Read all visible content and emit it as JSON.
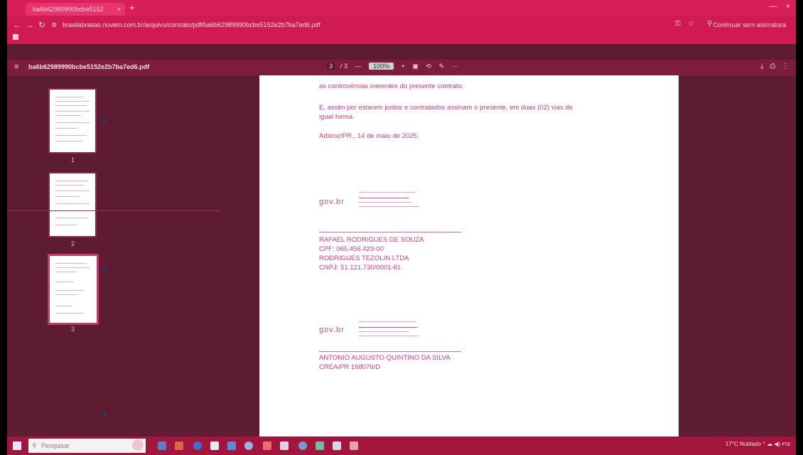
{
  "browser": {
    "tab_title": "ba6b62989990bcbe5152",
    "tab_close": "×",
    "new_tab": "+",
    "url": "brasilabrasao.nuvem.com.br/arquivo/contrato/pdf/ba6b62989990bcbe5152e2b7ba7ed6.pdf",
    "profile": "Continuar sem assinatura",
    "window_controls": [
      "—",
      "×"
    ]
  },
  "pdf_viewer": {
    "filename": "ba6b62989990bcbe5152e2b7ba7ed6.pdf",
    "page_current": "3",
    "page_total": "/ 3",
    "zoom": "100%",
    "icons": [
      "menu-icon",
      "zoom-out-icon",
      "zoom-in-icon",
      "fit-page-icon",
      "rotate-icon",
      "draw-icon",
      "download-icon",
      "print-icon",
      "more-icon"
    ]
  },
  "thumbnails": [
    {
      "label": "1"
    },
    {
      "label": "2"
    },
    {
      "label": "3"
    }
  ],
  "document": {
    "lines": [
      "as controvérsias inerentes do presente contrato.",
      "E, assim por estarem justos e contratados assinam o presente, em duas (02) vias de",
      "igual forma.",
      "Arbiroz/PR., 14 de maio de 2025."
    ],
    "signature1": {
      "logo": "gov.br",
      "name": "RAFAEL RODRIGUES DE SOUZA",
      "cpf": "CPF: 065.456.429-00",
      "company": "RODRIGUES TEZOLIN LTDA",
      "cnpj": "CNPJ: 51.121.730/0001-81"
    },
    "signature2": {
      "logo": "gov.br",
      "name": "ANTONIO AUGUSTO QUINTINO DA SILVA",
      "crea": "CREA/PR 168076/D"
    }
  },
  "taskbar": {
    "search_placeholder": "Pesquisar",
    "tray_text": "17°C  Nublado  ^  ☁  ◀)  ᴘᴛᴇ",
    "colors": {
      "bar": "#a2153d",
      "accent": "#d81f5a"
    }
  }
}
